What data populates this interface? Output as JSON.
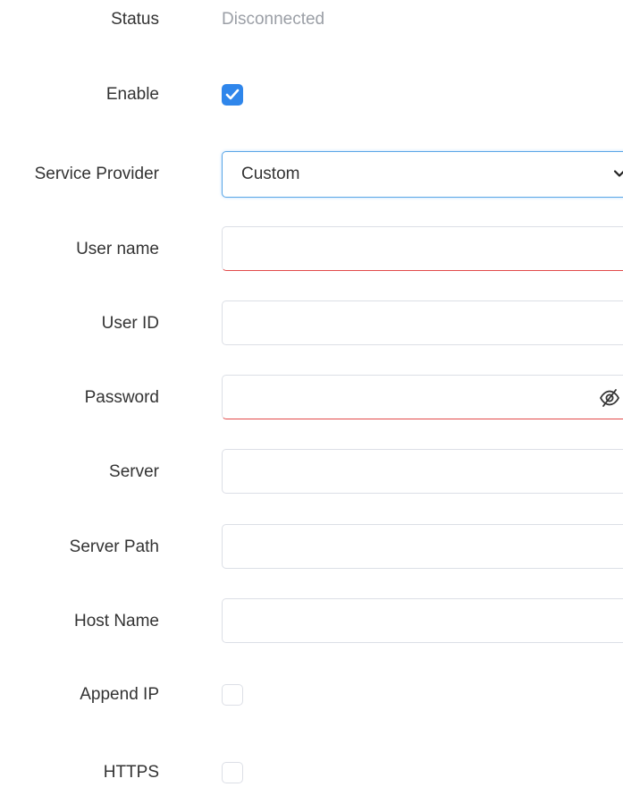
{
  "status": {
    "label": "Status",
    "value": "Disconnected"
  },
  "enable": {
    "label": "Enable",
    "checked": true
  },
  "service_provider": {
    "label": "Service Provider",
    "selected": "Custom"
  },
  "user_name": {
    "label": "User name",
    "value": ""
  },
  "user_id": {
    "label": "User ID",
    "value": ""
  },
  "password": {
    "label": "Password",
    "value": ""
  },
  "server": {
    "label": "Server",
    "value": ""
  },
  "server_path": {
    "label": "Server Path",
    "value": ""
  },
  "host_name": {
    "label": "Host Name",
    "value": ""
  },
  "append_ip": {
    "label": "Append IP",
    "checked": false
  },
  "https": {
    "label": "HTTPS",
    "checked": false
  },
  "colors": {
    "accent": "#2f86eb",
    "error": "#e24a4a",
    "muted_text": "#9b9fa6"
  }
}
